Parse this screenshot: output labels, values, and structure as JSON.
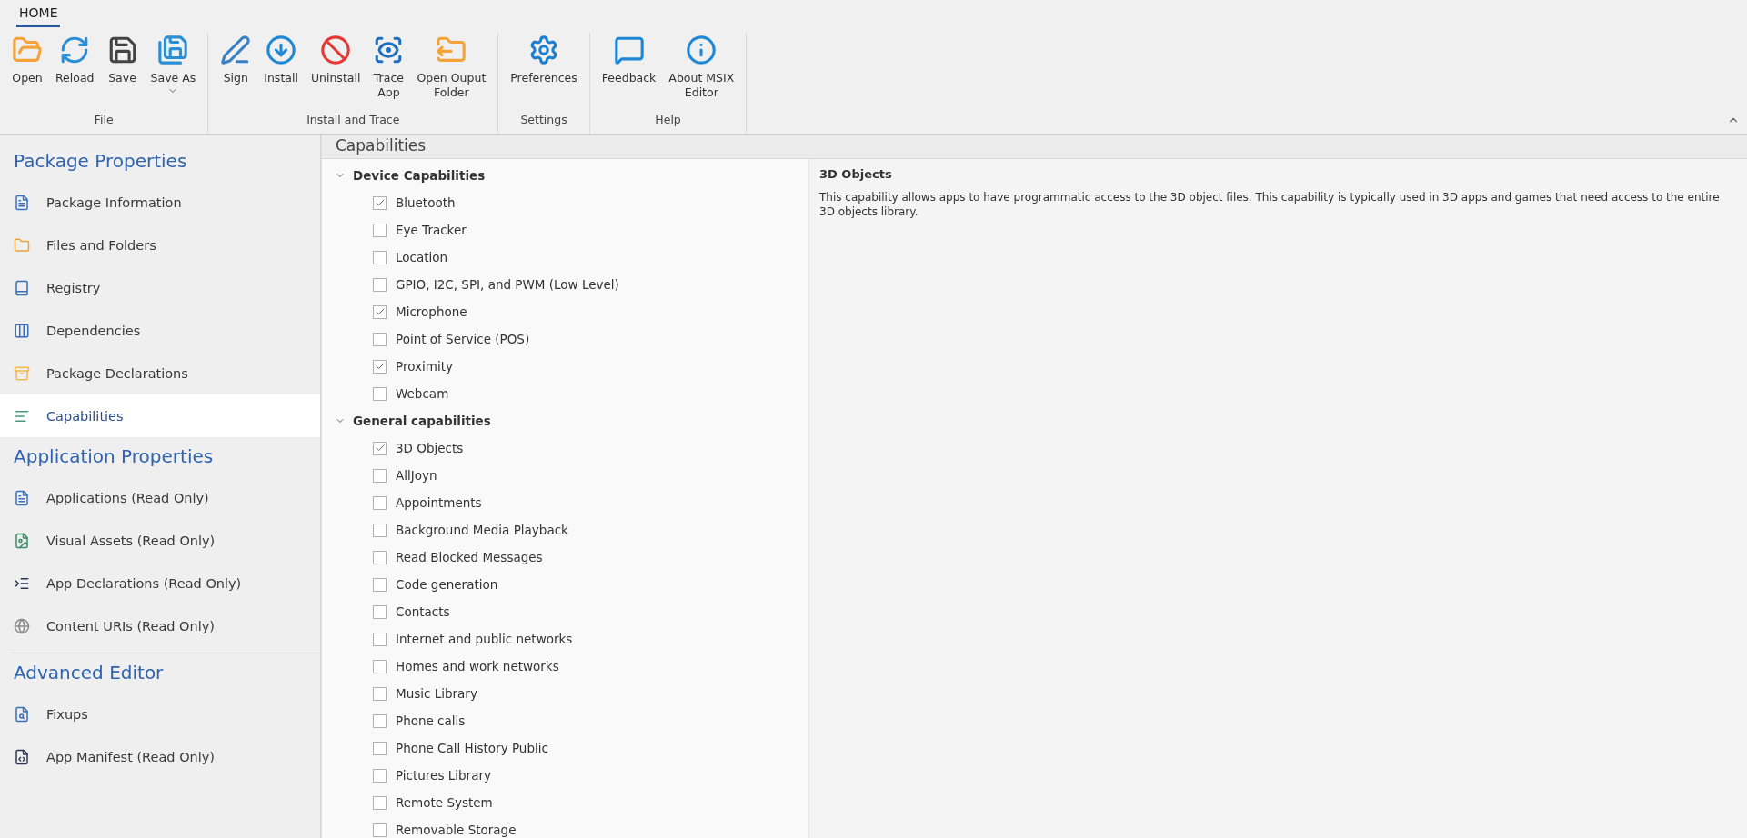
{
  "ribbon": {
    "tabs": [
      {
        "label": "HOME",
        "selected": true
      }
    ],
    "groups": [
      {
        "label": "File",
        "buttons": [
          {
            "lines": [
              "Open"
            ]
          },
          {
            "lines": [
              "Reload"
            ]
          },
          {
            "lines": [
              "Save"
            ]
          },
          {
            "lines": [
              "Save As"
            ],
            "dropdown": true
          }
        ]
      },
      {
        "label": "Install and Trace",
        "buttons": [
          {
            "lines": [
              "Sign"
            ]
          },
          {
            "lines": [
              "Install"
            ]
          },
          {
            "lines": [
              "Uninstall"
            ]
          },
          {
            "lines": [
              "Trace",
              "App"
            ]
          },
          {
            "lines": [
              "Open Ouput",
              "Folder"
            ]
          }
        ]
      },
      {
        "label": "Settings",
        "buttons": [
          {
            "lines": [
              "Preferences"
            ]
          }
        ]
      },
      {
        "label": "Help",
        "buttons": [
          {
            "lines": [
              "Feedback"
            ]
          },
          {
            "lines": [
              "About MSIX",
              "Editor"
            ]
          }
        ]
      }
    ]
  },
  "sidebar": {
    "sections": [
      {
        "title": "Package Properties",
        "items": [
          {
            "label": "Package Information",
            "selected": false
          },
          {
            "label": "Files and Folders",
            "selected": false
          },
          {
            "label": "Registry",
            "selected": false
          },
          {
            "label": "Dependencies",
            "selected": false
          },
          {
            "label": "Package Declarations",
            "selected": false
          },
          {
            "label": "Capabilities",
            "selected": true
          }
        ]
      },
      {
        "title": "Application Properties",
        "items": [
          {
            "label": "Applications (Read Only)",
            "selected": false
          },
          {
            "label": "Visual Assets (Read Only)",
            "selected": false
          },
          {
            "label": "App Declarations (Read Only)",
            "selected": false
          },
          {
            "label": "Content URIs (Read Only)",
            "selected": false
          }
        ]
      },
      {
        "title": "Advanced Editor",
        "items": [
          {
            "label": "Fixups",
            "selected": false
          },
          {
            "label": "App Manifest (Read Only)",
            "selected": false
          }
        ]
      }
    ]
  },
  "content": {
    "title": "Capabilities",
    "groups": [
      {
        "title": "Device Capabilities",
        "expanded": true,
        "items": [
          {
            "label": "Bluetooth",
            "checked": true
          },
          {
            "label": "Eye Tracker",
            "checked": false
          },
          {
            "label": "Location",
            "checked": false
          },
          {
            "label": "GPIO, I2C, SPI, and PWM (Low Level)",
            "checked": false
          },
          {
            "label": "Microphone",
            "checked": true
          },
          {
            "label": "Point of Service (POS)",
            "checked": false
          },
          {
            "label": "Proximity",
            "checked": true
          },
          {
            "label": "Webcam",
            "checked": false
          }
        ]
      },
      {
        "title": "General capabilities",
        "expanded": true,
        "items": [
          {
            "label": "3D Objects",
            "checked": true
          },
          {
            "label": "AllJoyn",
            "checked": false
          },
          {
            "label": "Appointments",
            "checked": false
          },
          {
            "label": "Background Media Playback",
            "checked": false
          },
          {
            "label": "Read Blocked Messages",
            "checked": false
          },
          {
            "label": "Code generation",
            "checked": false
          },
          {
            "label": "Contacts",
            "checked": false
          },
          {
            "label": "Internet and public networks",
            "checked": false
          },
          {
            "label": "Homes and work networks",
            "checked": false
          },
          {
            "label": "Music Library",
            "checked": false
          },
          {
            "label": "Phone calls",
            "checked": false
          },
          {
            "label": "Phone Call History Public",
            "checked": false
          },
          {
            "label": "Pictures Library",
            "checked": false
          },
          {
            "label": "Remote System",
            "checked": false
          },
          {
            "label": "Removable Storage",
            "checked": false
          }
        ]
      }
    ],
    "detail": {
      "title": "3D Objects",
      "text": "This capability allows apps to have programmatic access to the 3D object files. This capability is typically used in 3D apps and games that need access to the entire 3D objects library."
    }
  }
}
